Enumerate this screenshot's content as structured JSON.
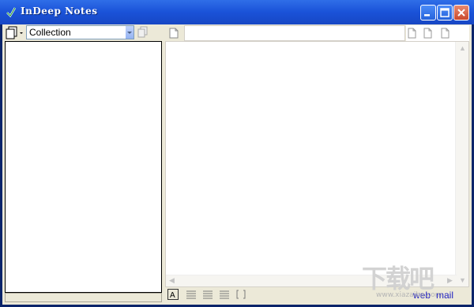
{
  "window": {
    "title": "InDeep Notes"
  },
  "collection": {
    "selected": "Collection"
  },
  "links": {
    "web": "web",
    "mail": "mail"
  },
  "watermark": {
    "logo_text": "下载吧",
    "url": "www.xiazaiba.com"
  },
  "colors": {
    "titlebar": "#1a52d8",
    "client": "#ece9d8",
    "link": "#2020c0",
    "close_button": "#c9492d"
  }
}
